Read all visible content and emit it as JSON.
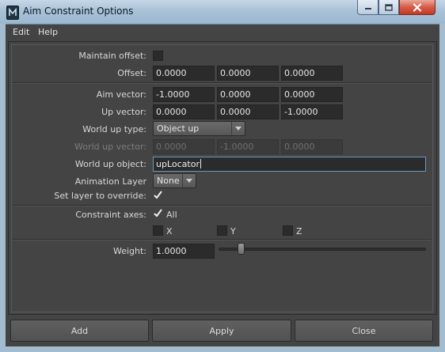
{
  "window": {
    "title": "Aim Constraint Options"
  },
  "menu": {
    "items": [
      "Edit",
      "Help"
    ]
  },
  "form": {
    "maintain_offset": {
      "label": "Maintain offset:",
      "checked": false
    },
    "offset": {
      "label": "Offset:",
      "values": [
        "0.0000",
        "0.0000",
        "0.0000"
      ]
    },
    "aim_vector": {
      "label": "Aim vector:",
      "values": [
        "-1.0000",
        "0.0000",
        "0.0000"
      ]
    },
    "up_vector": {
      "label": "Up vector:",
      "values": [
        "0.0000",
        "0.0000",
        "-1.0000"
      ]
    },
    "world_up_type": {
      "label": "World up type:",
      "selected": "Object up"
    },
    "world_up_vector": {
      "label": "World up vector:",
      "values": [
        "0.0000",
        "-1.0000",
        "0.0000"
      ],
      "enabled": false
    },
    "world_up_object": {
      "label": "World up object:",
      "value": "upLocator"
    },
    "animation_layer": {
      "label": "Animation Layer",
      "selected": "None"
    },
    "set_layer_override": {
      "label": "Set layer to override:",
      "checked": true
    },
    "constraint_axes": {
      "label": "Constraint axes:",
      "all": {
        "label": "All",
        "checked": true
      },
      "x": {
        "label": "X",
        "checked": false
      },
      "y": {
        "label": "Y",
        "checked": false
      },
      "z": {
        "label": "Z",
        "checked": false
      }
    },
    "weight": {
      "label": "Weight:",
      "value": "1.0000",
      "slider_fraction": 0.0
    }
  },
  "buttons": {
    "add": "Add",
    "apply": "Apply",
    "close": "Close"
  },
  "colors": {
    "panel": "#444444",
    "field": "#2b2b2b",
    "titlebar": "#a9c2d7",
    "focus_border": "#6f96c0",
    "close_button": "#c13a25"
  }
}
